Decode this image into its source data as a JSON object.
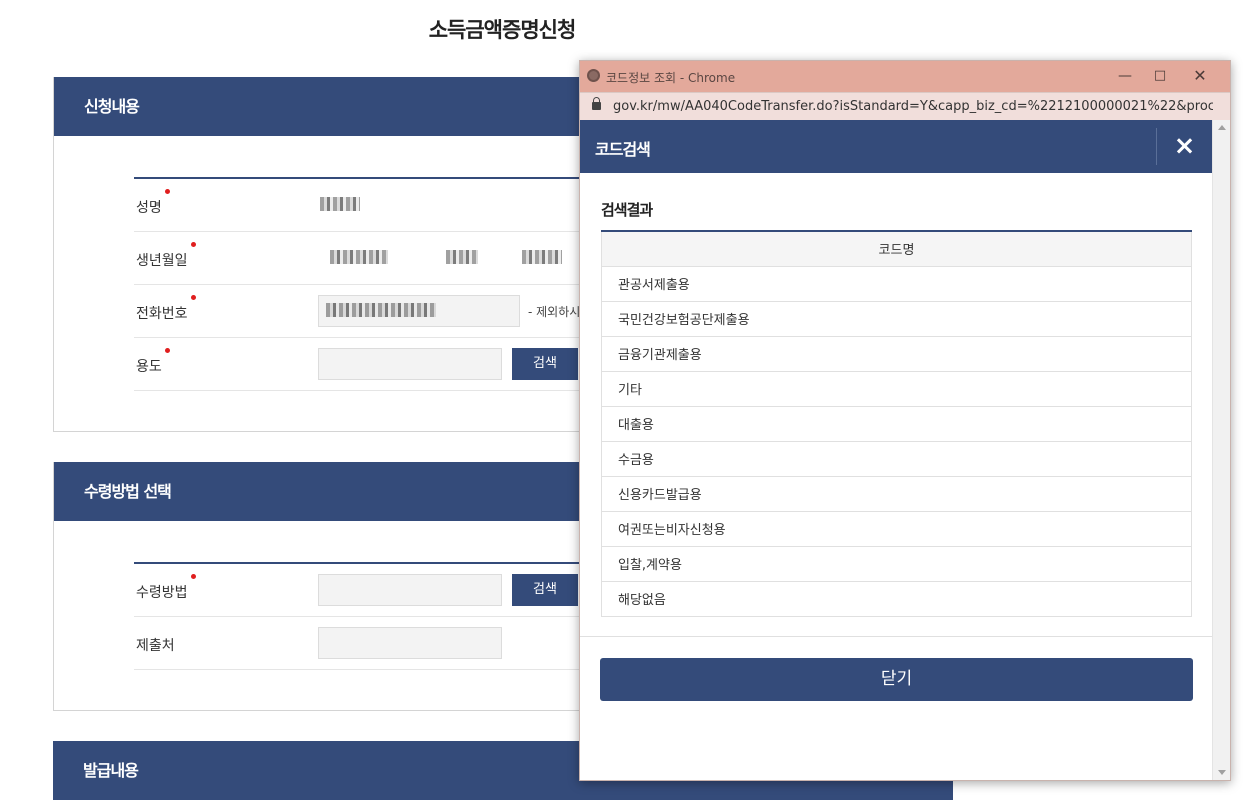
{
  "page": {
    "title": "소득금액증명신청"
  },
  "sections": {
    "application": {
      "title": "신청내용",
      "labels": {
        "name": "성명",
        "birth": "생년월일",
        "phone": "전화번호",
        "purpose": "용도"
      },
      "phone_note": "- 제외하시",
      "search_label": "검색"
    },
    "receipt": {
      "title": "수령방법 선택",
      "labels": {
        "method": "수령방법",
        "destination": "제출처"
      },
      "search_label": "검색"
    },
    "issuance": {
      "title": "발급내용"
    }
  },
  "popup": {
    "window_title": "코드정보 조회 - Chrome",
    "url": "gov.kr/mw/AA040CodeTransfer.do?isStandard=Y&capp_biz_cd=%2212100000021%22&proc_...",
    "header_title": "코드검색",
    "close_icon": "×",
    "result_title": "검색결과",
    "table_header": "코드명",
    "codes": [
      "관공서제출용",
      "국민건강보험공단제출용",
      "금융기관제출용",
      "기타",
      "대출용",
      "수금용",
      "신용카드발급용",
      "여권또는비자신청용",
      "입찰,계약용",
      "해당없음"
    ],
    "close_button": "닫기"
  },
  "colors": {
    "primary": "#344b7a",
    "titlebar": "#e3a99b",
    "required": "#e01e1e"
  }
}
